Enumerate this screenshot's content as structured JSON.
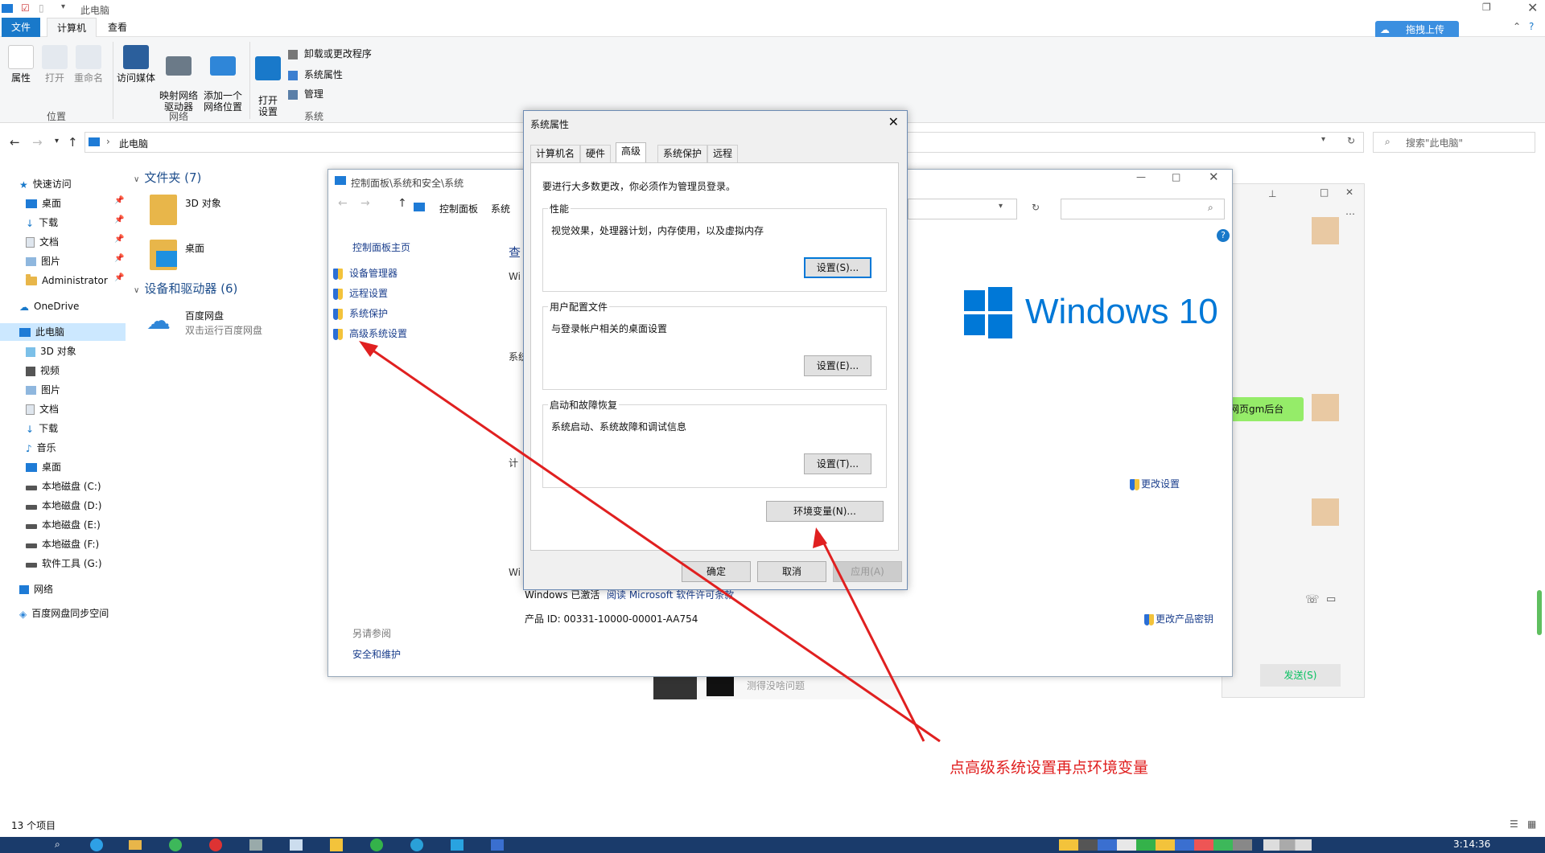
{
  "explorer": {
    "window_title": "此电脑",
    "tabs": [
      "文件",
      "计算机",
      "查看"
    ],
    "ribbon": {
      "location_group": "位置",
      "network_group": "网络",
      "system_group": "系统",
      "buttons": [
        "属性",
        "打开",
        "重命名",
        "访问媒体",
        "映射网络\n驱动器",
        "添加一个\n网络位置",
        "打开\n设置"
      ],
      "small_buttons": [
        "卸载或更改程序",
        "系统属性",
        "管理"
      ],
      "cloud_button": "拖拽上传"
    },
    "address": "此电脑",
    "search_placeholder": "搜索\"此电脑\"",
    "nav": {
      "quick_access": "快速访问",
      "quick_items": [
        "桌面",
        "下载",
        "文档",
        "图片",
        "Administrator"
      ],
      "onedrive": "OneDrive",
      "this_pc": "此电脑",
      "pc_items": [
        "3D 对象",
        "视频",
        "图片",
        "文档",
        "下载",
        "音乐",
        "桌面",
        "本地磁盘 (C:)",
        "本地磁盘 (D:)",
        "本地磁盘 (E:)",
        "本地磁盘 (F:)",
        "软件工具 (G:)"
      ],
      "network": "网络",
      "baidu_space": "百度网盘同步空间"
    },
    "content": {
      "folders_header": "文件夹 (7)",
      "folders": [
        "3D 对象",
        "桌面"
      ],
      "devices_header": "设备和驱动器 (6)",
      "baidu_name": "百度网盘",
      "baidu_desc": "双击运行百度网盘"
    },
    "status": "13 个项目"
  },
  "control_panel": {
    "title": "控制面板\\系统和安全\\系统",
    "breadcrumb": [
      "控制面板",
      "系统"
    ],
    "home": "控制面板主页",
    "menu": [
      "设备管理器",
      "远程设置",
      "系统保护",
      "高级系统设置"
    ],
    "see_also": "另请参阅",
    "see_also_item": "安全和维护",
    "activation": "Windows 已激活",
    "license_link": "阅读 Microsoft 软件许可条款",
    "product_id": "产品 ID: 00331-10000-00001-AA754",
    "change_settings": "更改设置",
    "change_key": "更改产品密钥",
    "win10": "Windows 10",
    "partial_texts": [
      "查",
      "Wi",
      "系统",
      "计",
      "Wi"
    ]
  },
  "chat": {
    "bubble": "网页gm后台",
    "send": "发送(S)",
    "input_hint": "测得没啥问题"
  },
  "dialog": {
    "title": "系统属性",
    "tabs": [
      "计算机名",
      "硬件",
      "高级",
      "系统保护",
      "远程"
    ],
    "admin_note": "要进行大多数更改，你必须作为管理员登录。",
    "perf_title": "性能",
    "perf_desc": "视觉效果，处理器计划，内存使用，以及虚拟内存",
    "perf_btn": "设置(S)...",
    "profile_title": "用户配置文件",
    "profile_desc": "与登录帐户相关的桌面设置",
    "profile_btn": "设置(E)...",
    "startup_title": "启动和故障恢复",
    "startup_desc": "系统启动、系统故障和调试信息",
    "startup_btn": "设置(T)...",
    "env_btn": "环境变量(N)...",
    "ok": "确定",
    "cancel": "取消",
    "apply": "应用(A)"
  },
  "annotation": "点高级系统设置再点环境变量",
  "clock": "3:14:36"
}
